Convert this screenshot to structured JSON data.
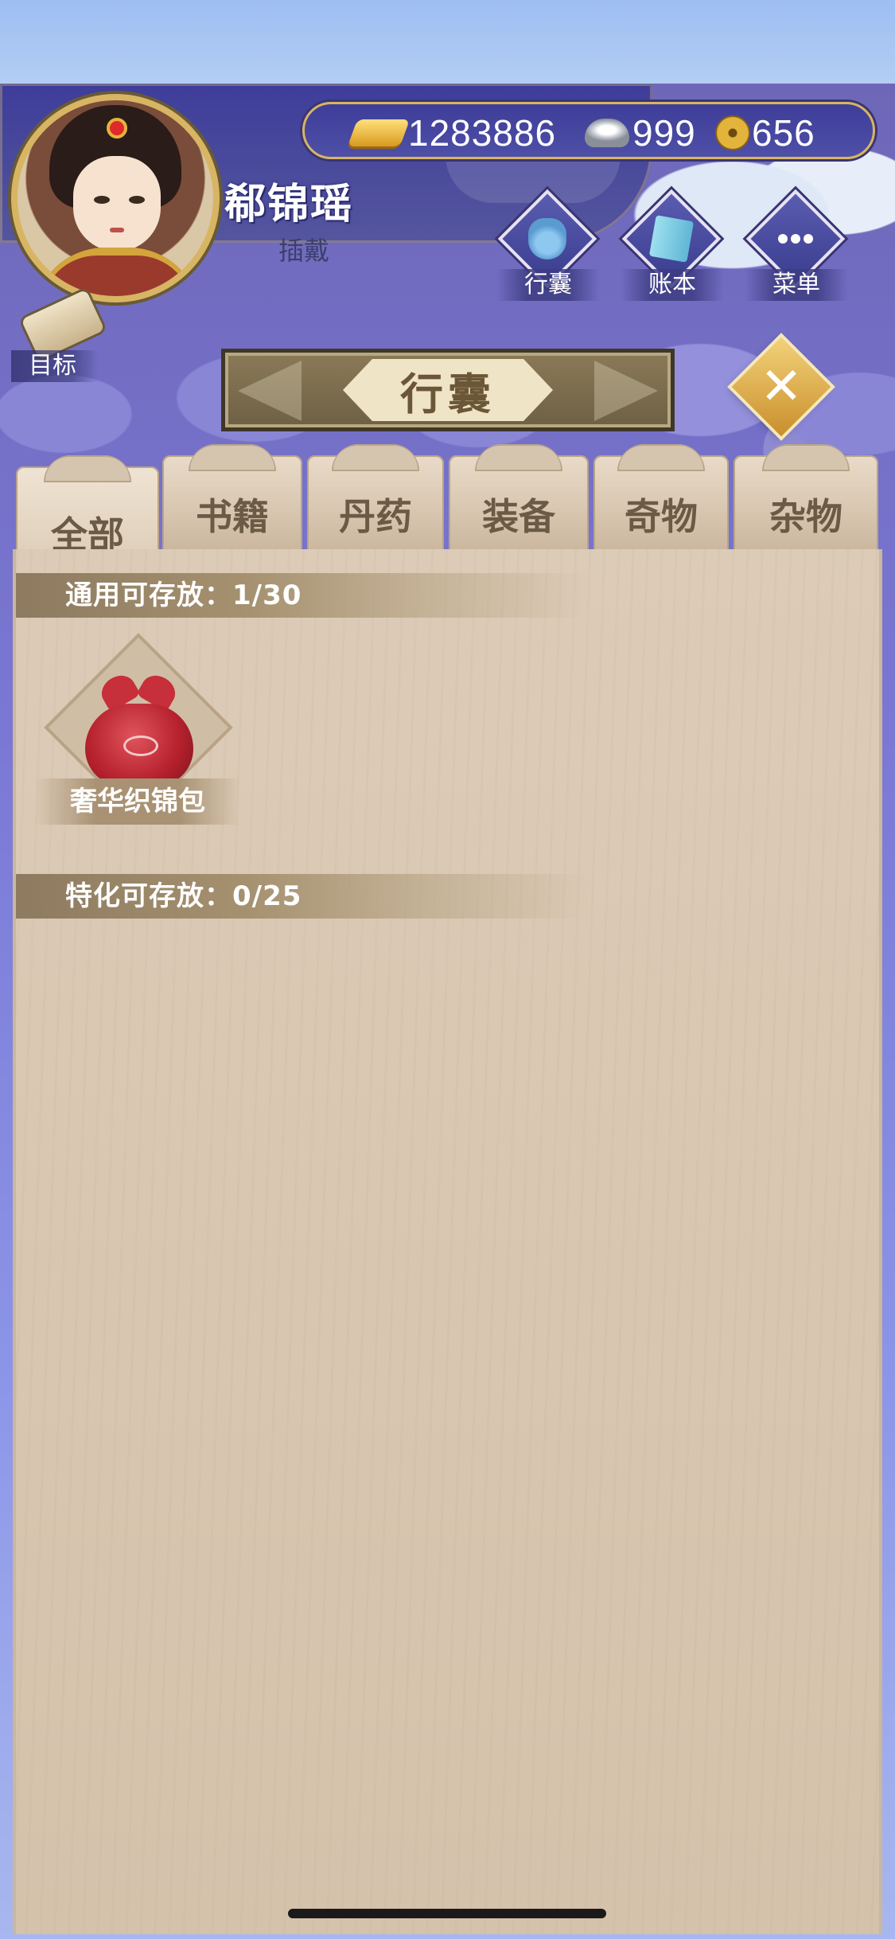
{
  "player": {
    "name": "郗锦瑶",
    "title": "插戴"
  },
  "currency": {
    "gold": "1283886",
    "silver": "999",
    "coin": "656"
  },
  "nav": {
    "bag": "行囊",
    "ledger": "账本",
    "menu": "菜单",
    "goal": "目标"
  },
  "panel_title": "行囊",
  "tabs": [
    "全部",
    "书籍",
    "丹药",
    "装备",
    "奇物",
    "杂物"
  ],
  "active_tab": "全部",
  "sections": {
    "general": "通用可存放：1/30",
    "special": "特化可存放：0/25"
  },
  "items": [
    {
      "name": "奢华织锦包",
      "icon": "red-silk-bundle-icon"
    }
  ],
  "colors": {
    "accent_gold": "#d7b563",
    "banner_purple": "#3e3d9a",
    "panel_wood": "#d5c2ab",
    "text_brown": "#6b5a45"
  }
}
